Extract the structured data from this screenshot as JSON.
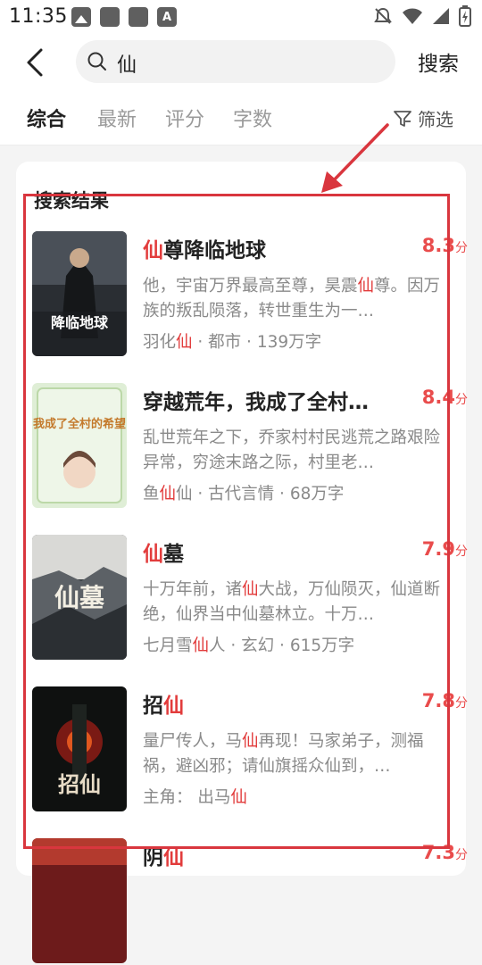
{
  "status_bar": {
    "time": "11:35",
    "left_icons": [
      "image-icon",
      "app-icon",
      "app-icon",
      "keyboard-a-icon"
    ],
    "right_icons": [
      "mute-icon",
      "wifi-icon",
      "signal-icon",
      "battery-charging-icon"
    ]
  },
  "header": {
    "search_query": "仙",
    "search_button": "搜索"
  },
  "tabs": [
    {
      "label": "综合",
      "active": true
    },
    {
      "label": "最新",
      "active": false
    },
    {
      "label": "评分",
      "active": false
    },
    {
      "label": "字数",
      "active": false
    }
  ],
  "filter_label": "筛选",
  "results": {
    "title": "搜索结果",
    "items": [
      {
        "title_hl": "仙",
        "title_rest": "尊降临地球",
        "score": "8.3",
        "score_unit": "分",
        "desc_a": "他，宇宙万界最高至尊，昊震",
        "desc_hl": "仙",
        "desc_b": "尊。因万族的叛乱陨落，转世重生为一…",
        "meta_a": "羽化",
        "meta_hl": "仙",
        "meta_b": " · 都市 · 139万字",
        "cover_text": "降临地球"
      },
      {
        "title_hl": "",
        "title_rest": "穿越荒年，我成了全村…",
        "score": "8.4",
        "score_unit": "分",
        "desc_a": "乱世荒年之下，乔家村村民逃荒之路艰险异常，穷途末路之际，村里老…",
        "desc_hl": "",
        "desc_b": "",
        "meta_a": "鱼",
        "meta_hl": "仙",
        "meta_b": "仙 · 古代言情 · 68万字",
        "cover_text": "我成了全村的希望"
      },
      {
        "title_hl": "仙",
        "title_rest": "墓",
        "score": "7.9",
        "score_unit": "分",
        "desc_a": "十万年前，诸",
        "desc_hl": "仙",
        "desc_b": "大战，万仙陨灭，仙道断绝，仙界当中仙墓林立。十万…",
        "meta_a": "七月雪",
        "meta_hl": "仙",
        "meta_b": "人 · 玄幻 · 615万字",
        "cover_text": "仙墓"
      },
      {
        "title_hl": "",
        "title_rest": "招",
        "title_hl2": "仙",
        "score": "7.8",
        "score_unit": "分",
        "desc_a": "量尸传人，马",
        "desc_hl": "仙",
        "desc_b": "再现！马家弟子，测福祸，避凶邪；请仙旗摇众仙到，…",
        "meta_a": "主角： 出马",
        "meta_hl": "仙",
        "meta_b": "",
        "cover_text": "招仙"
      },
      {
        "title_hl": "",
        "title_rest": "阴",
        "title_hl2": "仙",
        "score": "7.3",
        "score_unit": "分"
      }
    ]
  }
}
